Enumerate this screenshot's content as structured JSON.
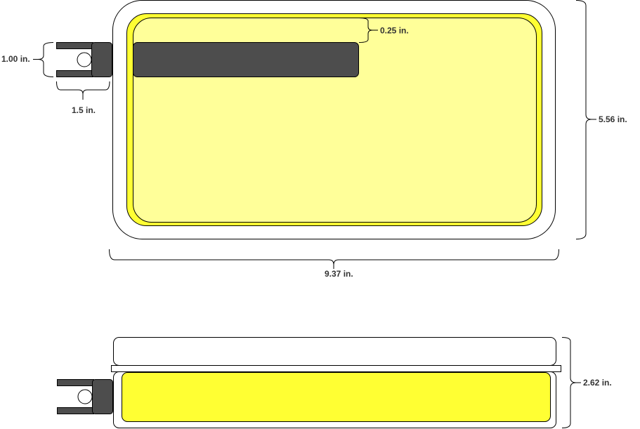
{
  "colors": {
    "outline": "#000000",
    "case_fill": "#ffffff",
    "liner_fill": "#ffff33",
    "inner_fill": "#ffff99",
    "bracket_fill": "#4d4d4d",
    "label_text": "#333333"
  },
  "top_view": {
    "width_label": "9.37 in.",
    "height_label": "5.56 in.",
    "inset_label": "0.25 in.",
    "bracket_height_label": "1.00 in.",
    "bracket_width_label": "1.5 in."
  },
  "side_view": {
    "height_label": "2.62 in."
  }
}
